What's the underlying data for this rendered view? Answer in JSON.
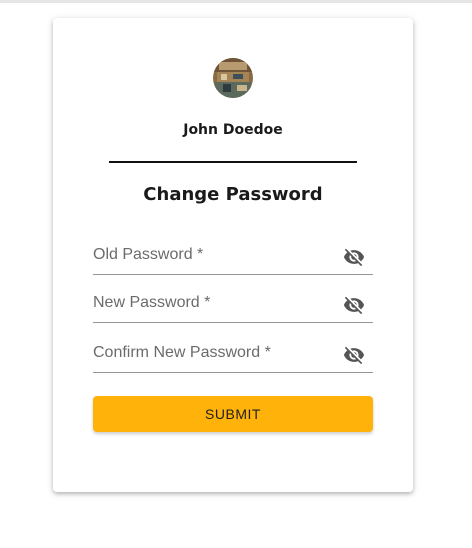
{
  "user": {
    "name": "John Doedoe"
  },
  "form": {
    "title": "Change Password",
    "fields": [
      {
        "label": "Old Password *"
      },
      {
        "label": "New Password *"
      },
      {
        "label": "Confirm New Password *"
      }
    ],
    "visibility_icon": "eye-off-icon",
    "submit_label": "SUBMIT"
  },
  "colors": {
    "accent": "#ffb30a",
    "divider": "#111111",
    "field_underline": "#949494",
    "label": "#6b6b6b"
  }
}
